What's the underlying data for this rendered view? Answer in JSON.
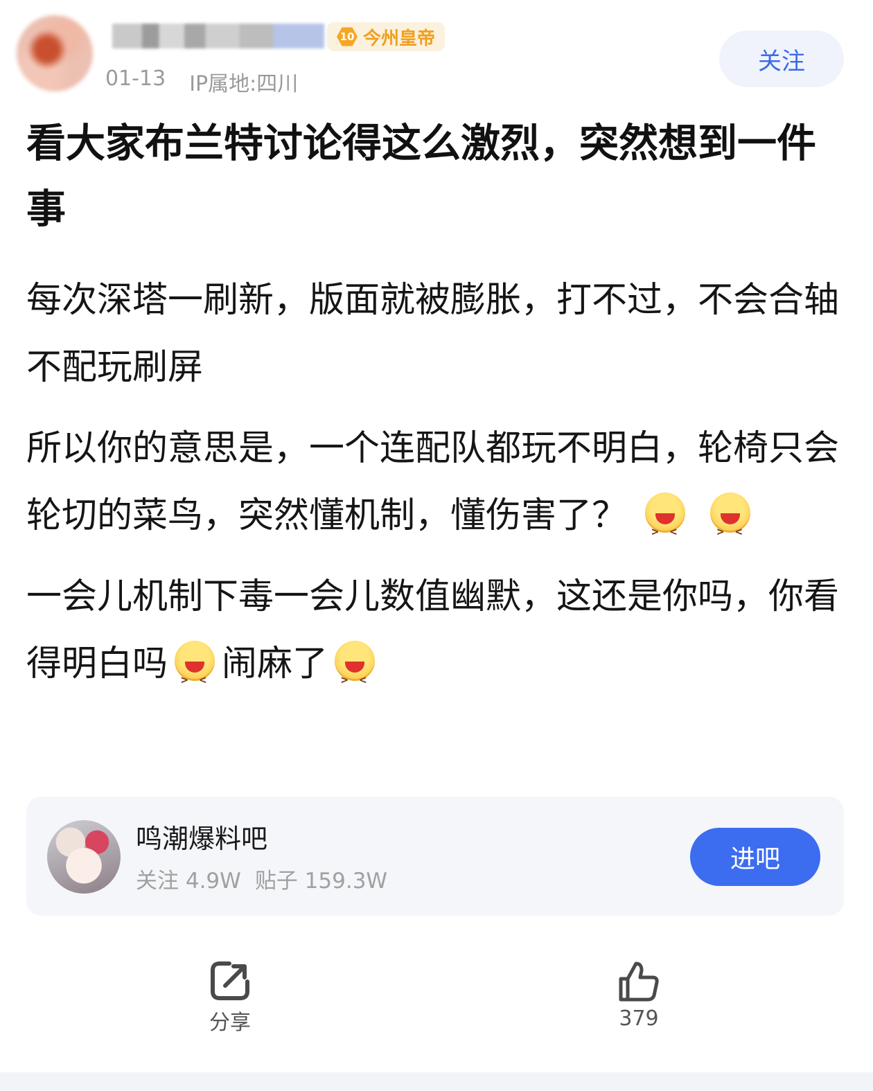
{
  "post_header": {
    "user_level": "10",
    "user_level_name": "今州皇帝",
    "date": "01-13",
    "ip_location": "IP属地:四川",
    "follow_label": "关注"
  },
  "post": {
    "title": "看大家布兰特讨论得这么激烈，突然想到一件事",
    "paragraph1": "每次深塔一刷新，版面就被膨胀，打不过，不会合轴不配玩刷屏",
    "paragraph2": "所以你的意思是，一个连配队都玩不明白，轮椅只会轮切的菜鸟，突然懂机制，懂伤害了？",
    "paragraph3_part1": "一会儿机制下毒一会儿数值幽默，这还是你吗，你看得明白吗",
    "paragraph3_part2": "闹麻了",
    "emoji_name": "laughing-squint-emoji"
  },
  "forum": {
    "name": "鸣潮爆料吧",
    "followers": "关注 4.9W",
    "posts": "贴子 159.3W",
    "enter_label": "进吧"
  },
  "actions": {
    "share_label": "分享",
    "like_count": "379"
  },
  "colors": {
    "accent": "#3c6cf0",
    "follow_text": "#3b6be8",
    "level_gold": "#f0a020"
  }
}
